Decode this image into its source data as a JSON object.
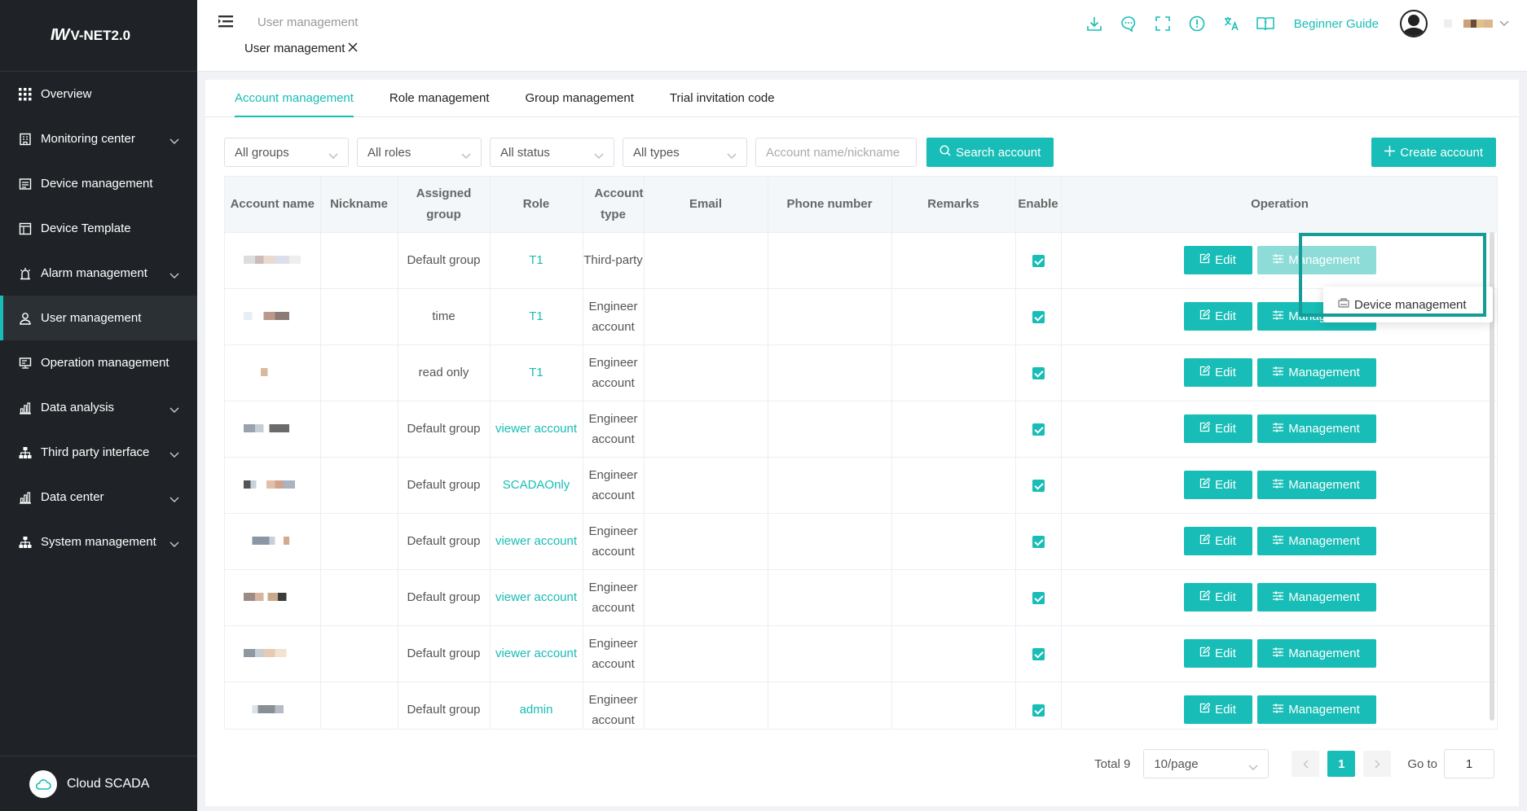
{
  "app": {
    "logo_text": "V-NET2.0",
    "footer_label": "Cloud SCADA"
  },
  "sidebar": {
    "items": [
      {
        "label": "Overview",
        "icon": "grid-icon",
        "expandable": false
      },
      {
        "label": "Monitoring center",
        "icon": "monitor-building-icon",
        "expandable": true
      },
      {
        "label": "Device management",
        "icon": "device-list-icon",
        "expandable": false
      },
      {
        "label": "Device Template",
        "icon": "template-icon",
        "expandable": false
      },
      {
        "label": "Alarm management",
        "icon": "alarm-icon",
        "expandable": true
      },
      {
        "label": "User management",
        "icon": "user-icon",
        "expandable": false,
        "active": true
      },
      {
        "label": "Operation management",
        "icon": "operation-icon",
        "expandable": false
      },
      {
        "label": "Data analysis",
        "icon": "bar-chart-icon",
        "expandable": true
      },
      {
        "label": "Third party interface",
        "icon": "hierarchy-icon",
        "expandable": true
      },
      {
        "label": "Data center",
        "icon": "bar-chart-icon",
        "expandable": true
      },
      {
        "label": "System management",
        "icon": "hierarchy-icon",
        "expandable": true
      }
    ]
  },
  "header": {
    "breadcrumb": "User management",
    "open_tag": "User management",
    "beginner_guide": "Beginner Guide",
    "tool_icons": [
      "download-icon",
      "message-icon",
      "fullscreen-icon",
      "info-icon",
      "translate-icon",
      "help-book-icon"
    ]
  },
  "tabs": [
    {
      "label": "Account management",
      "active": true
    },
    {
      "label": "Role management"
    },
    {
      "label": "Group management"
    },
    {
      "label": "Trial invitation code"
    }
  ],
  "filters": {
    "groups": "All groups",
    "roles": "All roles",
    "status": "All status",
    "types": "All types",
    "search_placeholder": "Account name/nickname",
    "search_button": "Search account",
    "create_button": "Create account"
  },
  "table": {
    "columns": [
      "Account name",
      "Nickname",
      "Assigned group",
      "Role",
      "Account type",
      "Email",
      "Phone number",
      "Remarks",
      "Enable",
      "Operation"
    ],
    "edit_label": "Edit",
    "management_label": "Management",
    "rows": [
      {
        "group": "Default group",
        "role": "T1",
        "type": "Third-party",
        "enabled": true
      },
      {
        "group": "time",
        "role": "T1",
        "type": "Engineer account",
        "enabled": true
      },
      {
        "group": "read only",
        "role": "T1",
        "type": "Engineer account",
        "enabled": true
      },
      {
        "group": "Default group",
        "role": "viewer account",
        "type": "Engineer account",
        "enabled": true
      },
      {
        "group": "Default group",
        "role": "SCADAOnly",
        "type": "Engineer account",
        "enabled": true
      },
      {
        "group": "Default group",
        "role": "viewer account",
        "type": "Engineer account",
        "enabled": true
      },
      {
        "group": "Default group",
        "role": "viewer account",
        "type": "Engineer account",
        "enabled": true
      },
      {
        "group": "Default group",
        "role": "viewer account",
        "type": "Engineer account",
        "enabled": true
      },
      {
        "group": "Default group",
        "role": "admin",
        "type": "Engineer account",
        "enabled": true
      }
    ]
  },
  "dropdown": {
    "item": "Device management"
  },
  "pagination": {
    "total": "Total 9",
    "page_size": "10/page",
    "current_page": "1",
    "goto_label": "Go to",
    "goto_value": "1"
  },
  "colors": {
    "accent": "#17bdb6",
    "sidebar_bg": "#1f2327",
    "highlight_border": "#159c96"
  }
}
